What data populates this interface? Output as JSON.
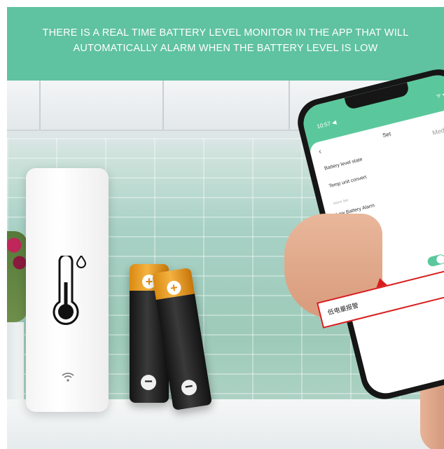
{
  "banner": {
    "line1": "THERE IS A REAL TIME BATTERY LEVEL MONITOR IN THE APP THAT WILL",
    "line2": "AUTOMATICALLY ALARM WHEN THE BATTERY LEVEL IS LOW",
    "bg_color": "#5fc2a0"
  },
  "batteries": [
    {
      "plus": "+",
      "minus": "−"
    },
    {
      "plus": "+",
      "minus": "−"
    }
  ],
  "phone": {
    "status_time": "10:57 ◀",
    "status_icons": "ᯤ ▪",
    "title": "Set",
    "battery_value": "Medium",
    "rows": [
      {
        "label": "Battery level state",
        "value": ""
      },
      {
        "label": "Temp unit convert",
        "value": "℉ ›"
      },
      {
        "label": "Alarm Set",
        "value": ""
      },
      {
        "label": "Low Battery Alarm",
        "value": ""
      }
    ],
    "accent_color": "#5ac89c"
  },
  "callout": {
    "text": "低电量报警"
  },
  "icons": [
    "thermometer-icon",
    "droplet-icon",
    "wifi-icon",
    "back-icon",
    "edit-icon"
  ]
}
